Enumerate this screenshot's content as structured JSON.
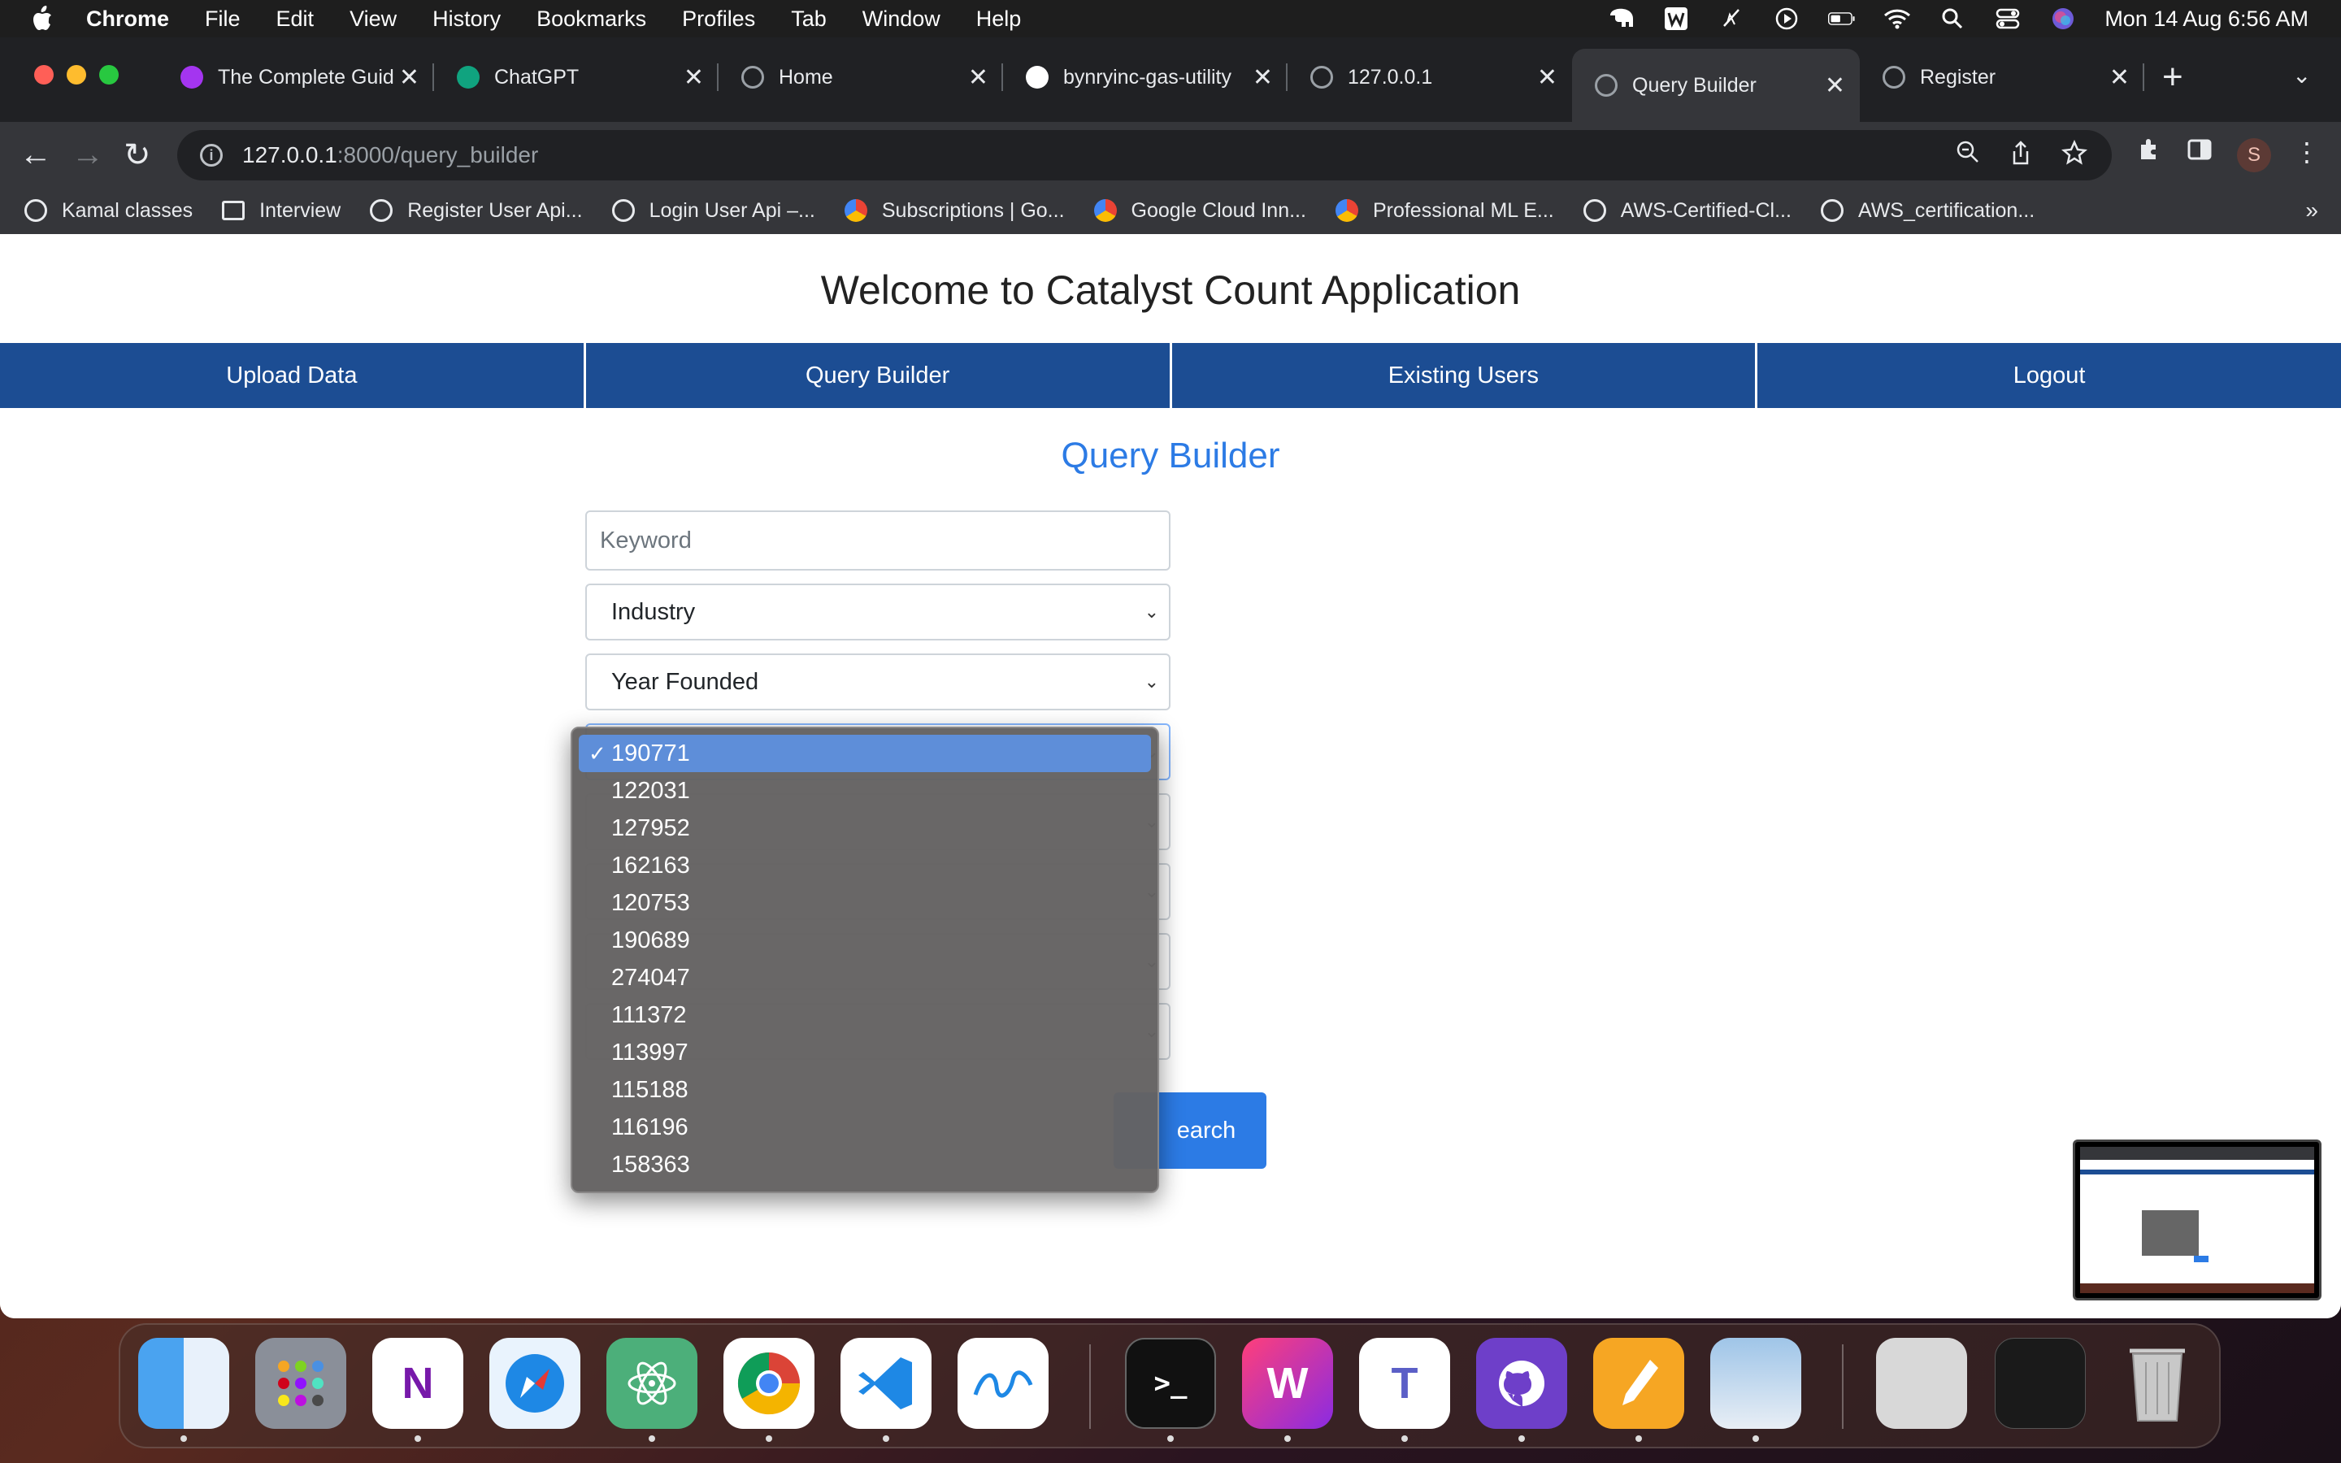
{
  "menubar": {
    "app": "Chrome",
    "items": [
      "File",
      "Edit",
      "View",
      "History",
      "Bookmarks",
      "Profiles",
      "Tab",
      "Window",
      "Help"
    ],
    "clock": "Mon 14 Aug  6:56 AM"
  },
  "tabs": [
    {
      "title": "The Complete Guid",
      "icon": "udemy-icon",
      "color": "#a435f0"
    },
    {
      "title": "ChatGPT",
      "icon": "chatgpt-icon",
      "color": "#10a37f"
    },
    {
      "title": "Home",
      "icon": "globe-icon",
      "color": "#9aa0a6"
    },
    {
      "title": "bynryinc-gas-utility",
      "icon": "github-icon",
      "color": "#ffffff"
    },
    {
      "title": "127.0.0.1",
      "icon": "globe-icon",
      "color": "#9aa0a6"
    },
    {
      "title": "Query Builder",
      "icon": "globe-icon",
      "color": "#9aa0a6",
      "active": true
    },
    {
      "title": "Register",
      "icon": "globe-icon",
      "color": "#9aa0a6"
    }
  ],
  "address": {
    "host": "127.0.0.1",
    "path": ":8000/query_builder"
  },
  "profile_initial": "S",
  "bookmarks": [
    {
      "label": "Kamal classes",
      "icon": "globe-icon"
    },
    {
      "label": "Interview",
      "icon": "folder-icon"
    },
    {
      "label": "Register User Api...",
      "icon": "globe-icon"
    },
    {
      "label": "Login User Api –...",
      "icon": "globe-icon"
    },
    {
      "label": "Subscriptions | Go...",
      "icon": "google-cloud-icon"
    },
    {
      "label": "Google Cloud Inn...",
      "icon": "google-cloud-icon"
    },
    {
      "label": "Professional ML E...",
      "icon": "google-cloud-icon"
    },
    {
      "label": "AWS-Certified-Cl...",
      "icon": "globe-icon"
    },
    {
      "label": "AWS_certification...",
      "icon": "globe-icon"
    }
  ],
  "page": {
    "welcome": "Welcome to Catalyst Count Application",
    "nav": [
      "Upload Data",
      "Query Builder",
      "Existing Users",
      "Logout"
    ],
    "title": "Query Builder",
    "keyword_placeholder": "Keyword",
    "industry_label": "Industry",
    "year_label": "Year Founded",
    "search_label": "Search",
    "search_visible": "earch"
  },
  "dropdown": {
    "selected": "190771",
    "options": [
      "190771",
      "122031",
      "127952",
      "162163",
      "120753",
      "190689",
      "274047",
      "111372",
      "113997",
      "115188",
      "116196",
      "158363"
    ]
  },
  "colors": {
    "nav_bg": "#1c4d93",
    "accent": "#2c7be5",
    "dropdown_highlight": "#5e8ed9"
  }
}
